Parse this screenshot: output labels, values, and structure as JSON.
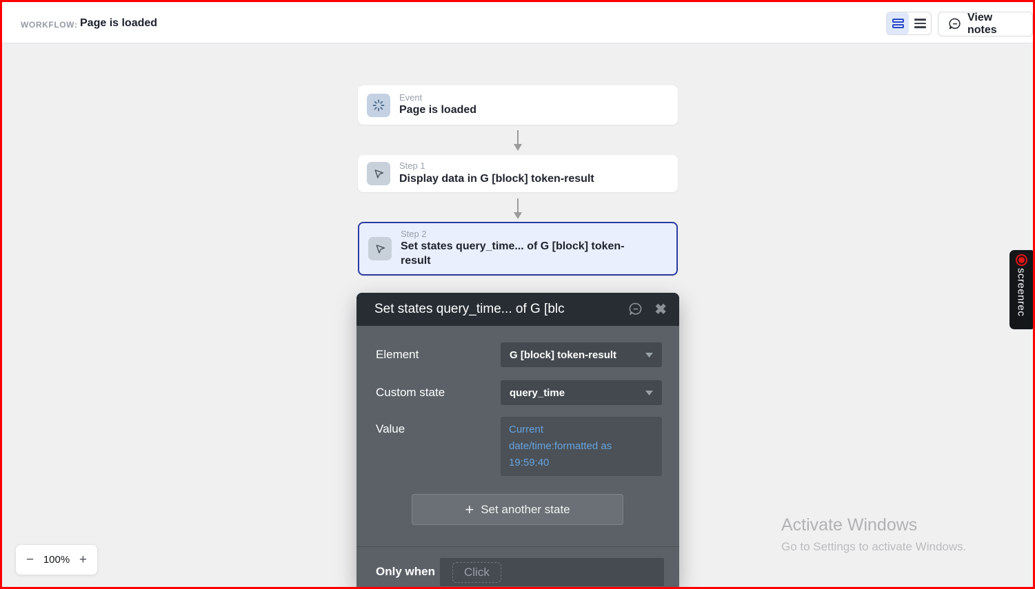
{
  "colors": {
    "frame_border": "#fe0000",
    "topbar_bg": "#ffffff",
    "canvas_bg": "#f0f0f1",
    "accent_blue": "#2946c6",
    "selected_card_border": "#2b3aa3",
    "selected_card_bg": "#e9effc",
    "popup_header_bg": "#272d33",
    "popup_body_bg": "#5b6167",
    "popup_control_bg": "#43494f",
    "expression_blue": "#66a3e0",
    "record_red": "#e31515"
  },
  "topbar": {
    "workflow_label": "WORKFLOW:",
    "workflow_name": "Page is loaded",
    "view_notes_label": "View notes"
  },
  "canvas": {
    "cards": [
      {
        "kind": "Event",
        "title": "Page is loaded"
      },
      {
        "kind": "Step 1",
        "title": "Display data in G [block] token-result"
      },
      {
        "kind": "Step 2",
        "title": "Set states query_time... of G [block] token-result"
      }
    ],
    "zoom": {
      "out": "−",
      "level": "100%",
      "in": "+"
    }
  },
  "popup": {
    "title": "Set states query_time... of G [blc",
    "element_label": "Element",
    "element_value": "G [block] token-result",
    "custom_state_label": "Custom state",
    "custom_state_value": "query_time",
    "value_label": "Value",
    "value_expression": "Current\ndate/time:formatted as\n19:59:40",
    "add_button_plus": "+",
    "add_button_label": "Set another state",
    "only_when_label": "Only when",
    "only_when_placeholder": "Click"
  },
  "overlays": {
    "screenrec_label": "screenrec",
    "activate_title": "Activate Windows",
    "activate_subtitle": "Go to Settings to activate Windows."
  },
  "icons": {
    "event_card": "page-load-spinner-icon",
    "step_card": "action-cursor-icon",
    "toggle_left": "card-view-icon",
    "toggle_right": "list-view-icon",
    "view_notes": "comment-bubble-icon",
    "popup_note": "comment-bubble-icon",
    "popup_close": "close-x-icon",
    "dropdown": "caret-down-icon",
    "connector": "arrow-down-icon",
    "record": "record-dot-icon"
  }
}
